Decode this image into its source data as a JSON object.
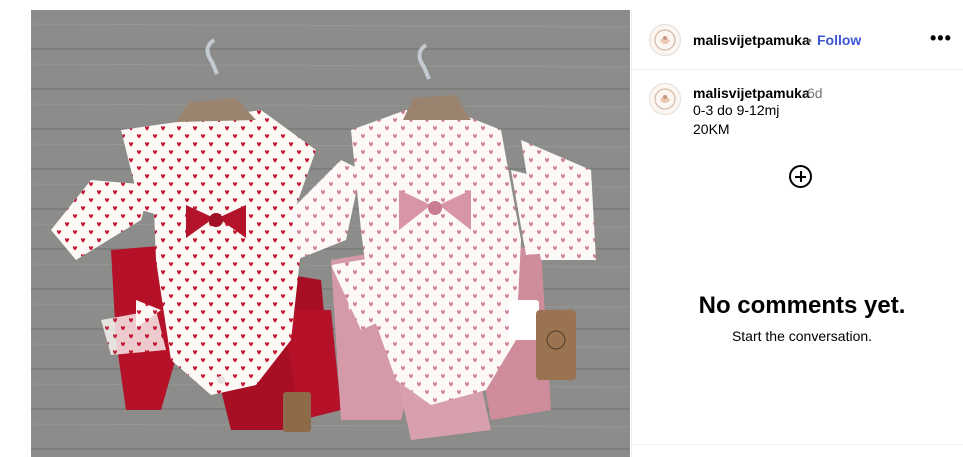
{
  "post": {
    "username": "malisvijetpamuka",
    "separator": "•",
    "follow_label": "Follow",
    "more_label": "•••",
    "avatar_icon": "logo-avatar-icon",
    "image_alt_icon": "baby-clothes-photo"
  },
  "caption": {
    "username": "malisvijetpamuka",
    "time": "6d",
    "line1": "0-3 do 9-12mj",
    "line2": "20KM"
  },
  "comments": {
    "add_icon": "plus-circle-icon",
    "empty_title": "No comments yet.",
    "empty_subtitle": "Start the conversation."
  },
  "colors": {
    "follow": "#3d55d6",
    "red_set": "#b5122a",
    "pink_set": "#d99aa8",
    "background_floor": "#8d8d8b"
  }
}
